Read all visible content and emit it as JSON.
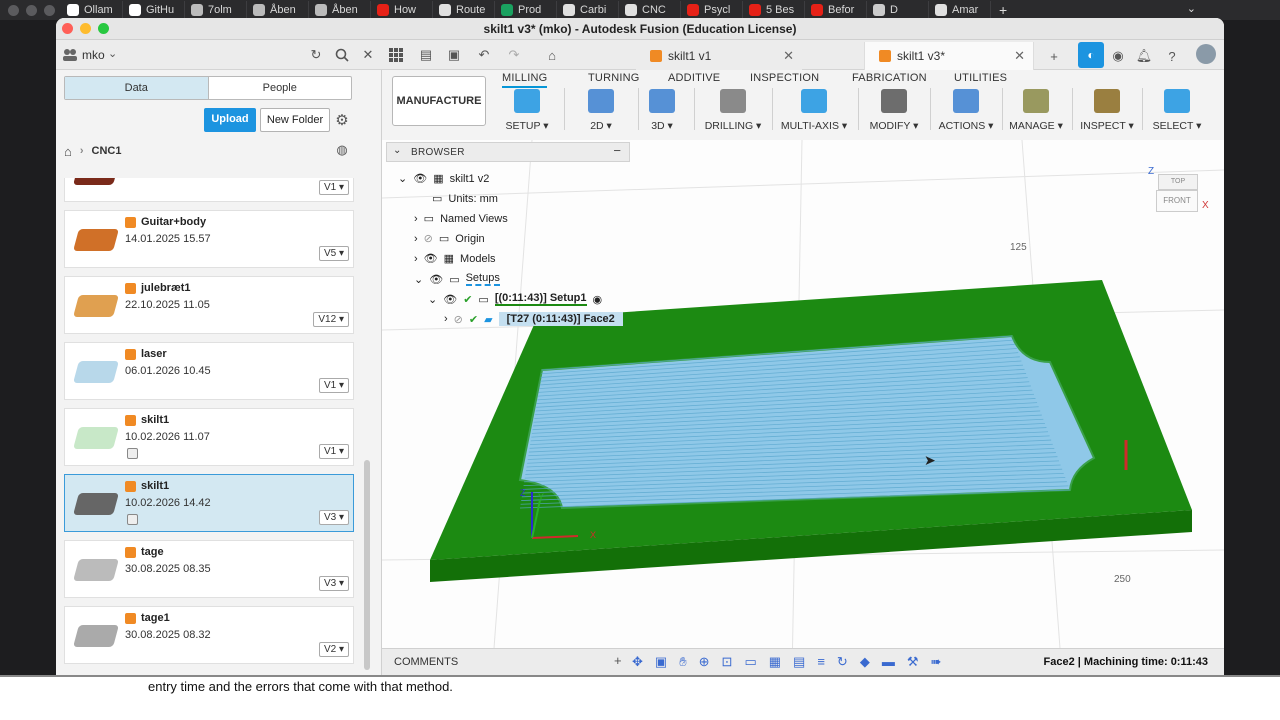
{
  "browser_tabs": [
    {
      "label": "Ollam",
      "color": "#ffffff"
    },
    {
      "label": "GitHu",
      "color": "#ffffff"
    },
    {
      "label": "7olm",
      "color": "#bbbbbb"
    },
    {
      "label": "Åben",
      "color": "#bbbbbb"
    },
    {
      "label": "Åben",
      "color": "#bbbbbb"
    },
    {
      "label": "How",
      "color": "#e62117"
    },
    {
      "label": "Route",
      "color": "#e0e0e0"
    },
    {
      "label": "Prod",
      "color": "#1aa260"
    },
    {
      "label": "Carbi",
      "color": "#e0e0e0"
    },
    {
      "label": "CNC",
      "color": "#e0e0e0"
    },
    {
      "label": "Psycl",
      "color": "#e62117"
    },
    {
      "label": "5 Bes",
      "color": "#e62117"
    },
    {
      "label": "Befor",
      "color": "#e62117"
    },
    {
      "label": "D",
      "color": "#cccccc"
    },
    {
      "label": "Amar",
      "color": "#e0e0e0"
    }
  ],
  "window_title": "skilt1 v3* (mko) - Autodesk Fusion (Education License)",
  "user_name": "mko",
  "doc_tabs": [
    {
      "label": "skilt1 v1"
    },
    {
      "label": "skilt1 v3*"
    }
  ],
  "data_panel": {
    "tab_data": "Data",
    "tab_people": "People",
    "upload": "Upload",
    "new_folder": "New Folder",
    "breadcrumb": "CNC1",
    "files": [
      {
        "name": "",
        "date": "",
        "version": "V1"
      },
      {
        "name": "Guitar+body",
        "date": "14.01.2025 15.57",
        "version": "V5"
      },
      {
        "name": "julebræt1",
        "date": "22.10.2025 11.05",
        "version": "V12"
      },
      {
        "name": "laser",
        "date": "06.01.2026 10.45",
        "version": "V1"
      },
      {
        "name": "skilt1",
        "date": "10.02.2026 11.07",
        "version": "V1"
      },
      {
        "name": "skilt1",
        "date": "10.02.2026 14.42",
        "version": "V3"
      },
      {
        "name": "tage",
        "date": "30.08.2025 08.35",
        "version": "V3"
      },
      {
        "name": "tage1",
        "date": "30.08.2025 08.32",
        "version": "V2"
      }
    ]
  },
  "workspace": "MANUFACTURE",
  "toolbar_tabs": [
    "MILLING",
    "TURNING",
    "ADDITIVE",
    "INSPECTION",
    "FABRICATION",
    "UTILITIES"
  ],
  "toolbar_groups": [
    {
      "label": "SETUP ▾"
    },
    {
      "label": "2D ▾"
    },
    {
      "label": "3D ▾"
    },
    {
      "label": "DRILLING ▾"
    },
    {
      "label": "MULTI-AXIS ▾"
    },
    {
      "label": "MODIFY ▾"
    },
    {
      "label": "ACTIONS ▾"
    },
    {
      "label": "MANAGE ▾"
    },
    {
      "label": "INSPECT ▾"
    },
    {
      "label": "SELECT ▾"
    }
  ],
  "browser": {
    "title": "BROWSER",
    "root": "skilt1 v2",
    "units": "Units: mm",
    "named_views": "Named Views",
    "origin": "Origin",
    "models": "Models",
    "setups": "Setups",
    "setup1": "[(0:11:43)] Setup1",
    "face2": "[T27 (0:11:43)] Face2"
  },
  "viewcube": {
    "top": "TOP",
    "front": "FRONT",
    "x": "X",
    "z": "Z"
  },
  "grid_labels": {
    "a": "125",
    "b": "250"
  },
  "triad": {
    "x": "X",
    "y": "Y",
    "z": "Z"
  },
  "comments": "COMMENTS",
  "status": "Face2 | Machining time: 0:11:43",
  "colors": {
    "accent": "#0696d7",
    "stock_green": "#1c8a12",
    "toolpath_blue": "#8fc8e8",
    "brand_orange": "#f08a24"
  },
  "underlying_doc": {
    "line1": "entry time and the errors that come with that method."
  }
}
